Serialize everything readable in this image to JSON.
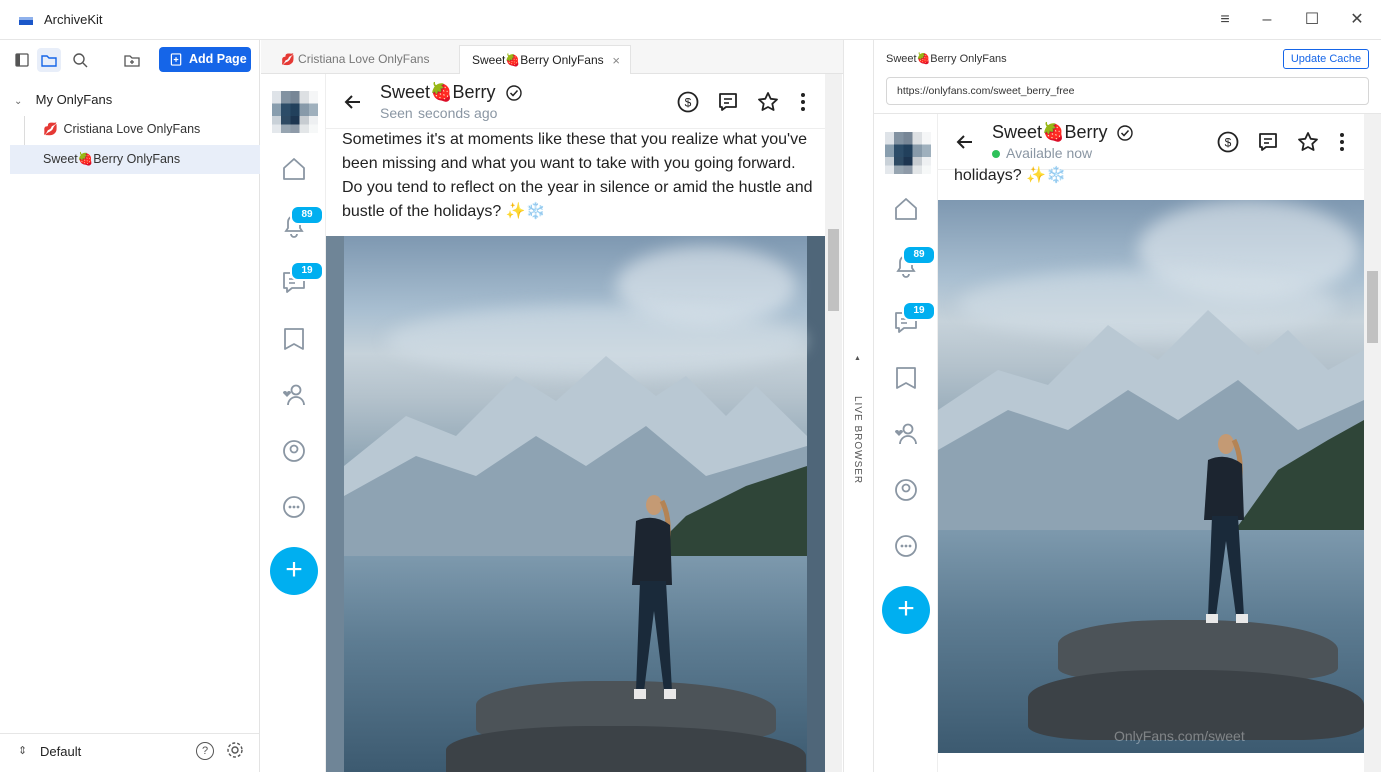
{
  "app": {
    "title": "ArchiveKit"
  },
  "window_controls": {
    "menu": "≡",
    "minimize": "–",
    "maximize": "☐",
    "close": "✕"
  },
  "sidebar": {
    "add_page_label": "Add Page",
    "group": {
      "label": "My OnlyFans"
    },
    "items": [
      {
        "label": "Cristiana Love OnlyFans",
        "icon": "💋",
        "selected": false
      },
      {
        "label": "Sweet🍓Berry OnlyFans",
        "icon": "",
        "selected": true
      }
    ],
    "footer": {
      "profile_label": "Default"
    }
  },
  "tabs": [
    {
      "label": "Cristiana Love OnlyFans",
      "icon": "💋",
      "active": false
    },
    {
      "label": "Sweet🍓Berry OnlyFans",
      "icon": "",
      "active": true,
      "close": "×"
    }
  ],
  "left_view": {
    "profile_name": "Sweet🍓Berry",
    "status_prefix": "Seen",
    "status_text": "seconds ago",
    "badges": {
      "notifications": "89",
      "messages": "19"
    },
    "post_text": "Sometimes it's at moments like these that you realize what you've been missing and what you want to take with you going forward. Do you tend to reflect on the year in silence or amid the hustle and bustle of the holidays? ✨❄️"
  },
  "divider": {
    "label": "LIVE BROWSER",
    "arrow": "▲"
  },
  "right_view": {
    "page_title": "Sweet🍓Berry OnlyFans",
    "update_cache_label": "Update Cache",
    "url": "https://onlyfans.com/sweet_berry_free",
    "profile_name": "Sweet🍓Berry",
    "status_text": "Available now",
    "badges": {
      "notifications": "89",
      "messages": "19"
    },
    "post_text_fragment": "holidays? ✨❄️",
    "watermark": "OnlyFans.com/sweet"
  },
  "colors": {
    "accent": "#1565e8",
    "of_blue": "#00aff0",
    "online_green": "#2ec15a"
  }
}
